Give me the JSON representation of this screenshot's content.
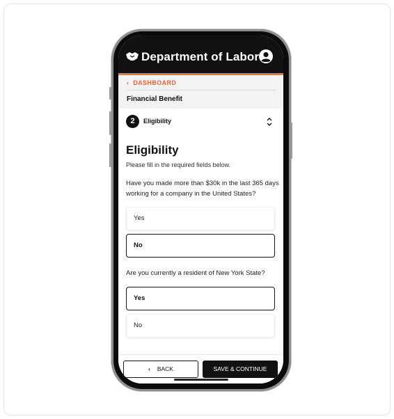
{
  "app": {
    "title": "Department of Labor",
    "accent_color": "#e8753e",
    "icons": {
      "logo": "handshake-icon",
      "account": "user-circle-icon"
    }
  },
  "breadcrumb": {
    "label": "DASHBOARD",
    "icon": "chevron-left-icon"
  },
  "flow": {
    "title": "Financial Benefit"
  },
  "step": {
    "number": "2",
    "label": "Eligibility",
    "icon": "chevron-up-down-icon"
  },
  "page": {
    "heading": "Eligibility",
    "instructions": "Please fill in the required fields below."
  },
  "questions": [
    {
      "text": "Have you made more than $30k in the last 365 days working for a company in the United States?",
      "options": [
        "Yes",
        "No"
      ],
      "selected": "No"
    },
    {
      "text": "Are you currently a resident of New York State?",
      "options": [
        "Yes",
        "No"
      ],
      "selected": "Yes"
    }
  ],
  "footer": {
    "back_label": "BACK",
    "continue_label": "SAVE & CONTINUE"
  }
}
